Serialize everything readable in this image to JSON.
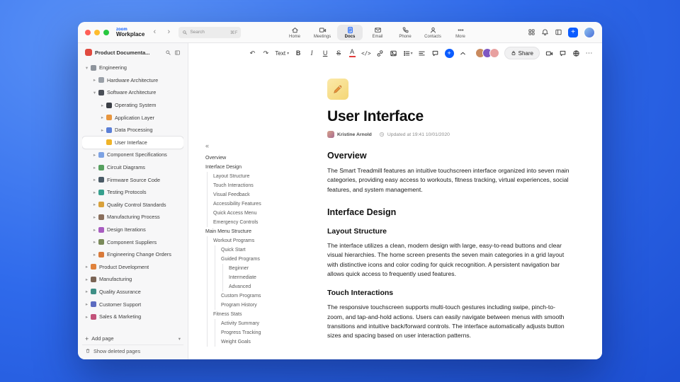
{
  "titlebar": {
    "logo_top": "zoom",
    "logo_bottom": "Workplace",
    "search_placeholder": "Search",
    "search_shortcut": "⌘F",
    "tabs": [
      {
        "label": "Home",
        "active": false
      },
      {
        "label": "Meetings",
        "active": false
      },
      {
        "label": "Docs",
        "active": true
      },
      {
        "label": "Email",
        "active": false
      },
      {
        "label": "Phone",
        "active": false
      },
      {
        "label": "Contacts",
        "active": false
      },
      {
        "label": "More",
        "active": false
      }
    ],
    "accent_color": "#0b5cff"
  },
  "sidebar": {
    "workspace_title": "Product Documenta...",
    "add_page_label": "Add page",
    "show_deleted_label": "Show deleted pages",
    "tree": [
      {
        "label": "Engineering",
        "level": 0,
        "chevron": "down",
        "icon": "gear",
        "color": "#8e949c"
      },
      {
        "label": "Hardware Architecture",
        "level": 1,
        "chevron": "right",
        "icon": "wrench",
        "color": "#9aa0a8"
      },
      {
        "label": "Software Architecture",
        "level": 1,
        "chevron": "down",
        "icon": "laptop",
        "color": "#4a4f57"
      },
      {
        "label": "Operating System",
        "level": 2,
        "chevron": "right",
        "icon": "disc",
        "color": "#3b3f46"
      },
      {
        "label": "Application Layer",
        "level": 2,
        "chevron": "right",
        "icon": "package",
        "color": "#e8963f"
      },
      {
        "label": "Data Processing",
        "level": 2,
        "chevron": "right",
        "icon": "chart",
        "color": "#5b7fd6"
      },
      {
        "label": "User Interface",
        "level": 2,
        "chevron": null,
        "icon": "memo",
        "color": "#f0b429",
        "selected": true
      },
      {
        "label": "Component Specifications",
        "level": 1,
        "chevron": "right",
        "icon": "clipboard",
        "color": "#7da2e3"
      },
      {
        "label": "Circuit Diagrams",
        "level": 1,
        "chevron": "right",
        "icon": "plug",
        "color": "#56a05f"
      },
      {
        "label": "Firmware Source Code",
        "level": 1,
        "chevron": "right",
        "icon": "floppy",
        "color": "#4a5a66"
      },
      {
        "label": "Testing Protocols",
        "level": 1,
        "chevron": "right",
        "icon": "test-tube",
        "color": "#37a08e"
      },
      {
        "label": "Quality Control Standards",
        "level": 1,
        "chevron": "right",
        "icon": "check-badge",
        "color": "#d9a13b"
      },
      {
        "label": "Manufacturing Process",
        "level": 1,
        "chevron": "right",
        "icon": "factory",
        "color": "#8a6f5c"
      },
      {
        "label": "Design Iterations",
        "level": 1,
        "chevron": "right",
        "icon": "pencil",
        "color": "#a85cc0"
      },
      {
        "label": "Component Suppliers",
        "level": 1,
        "chevron": "right",
        "icon": "box",
        "color": "#7a8a5a"
      },
      {
        "label": "Engineering Change Orders",
        "level": 1,
        "chevron": "right",
        "icon": "document",
        "color": "#d97a3a"
      },
      {
        "label": "Product Development",
        "level": 0,
        "chevron": "right",
        "icon": "rocket",
        "color": "#e0823c"
      },
      {
        "label": "Manufacturing",
        "level": 0,
        "chevron": "right",
        "icon": "factory",
        "color": "#7a6455"
      },
      {
        "label": "Quality Assurance",
        "level": 0,
        "chevron": "right",
        "icon": "magnifier",
        "color": "#3f8f86"
      },
      {
        "label": "Customer Support",
        "level": 0,
        "chevron": "right",
        "icon": "speech-bubble",
        "color": "#5c6bc0"
      },
      {
        "label": "Sales & Marketing",
        "level": 0,
        "chevron": "right",
        "icon": "chart-up",
        "color": "#c2527a"
      }
    ]
  },
  "editor_toolbar": {
    "text_style_label": "Text",
    "share_label": "Share",
    "avatars": [
      "#c98a5e",
      "#7e57c2",
      "#e8a0a0"
    ],
    "insert_color": "#0b5cff"
  },
  "outline": {
    "items": [
      {
        "label": "Overview",
        "level": 0
      },
      {
        "label": "Interface Design",
        "level": 0
      },
      {
        "label": "Layout Structure",
        "level": 1
      },
      {
        "label": "Touch Interactions",
        "level": 1
      },
      {
        "label": "Visual Feedback",
        "level": 1
      },
      {
        "label": "Accessibility Features",
        "level": 1
      },
      {
        "label": "Quick Access Menu",
        "level": 1
      },
      {
        "label": "Emergency Controls",
        "level": 1
      },
      {
        "label": "Main Menu Structure",
        "level": 0
      },
      {
        "label": "Workout Programs",
        "level": 1
      },
      {
        "label": "Quick Start",
        "level": 2
      },
      {
        "label": "Guided Programs",
        "level": 2
      },
      {
        "label": "Beginner",
        "level": 3
      },
      {
        "label": "Intermediate",
        "level": 3
      },
      {
        "label": "Advanced",
        "level": 3
      },
      {
        "label": "Custom Programs",
        "level": 2
      },
      {
        "label": "Program History",
        "level": 2
      },
      {
        "label": "Fitness Stats",
        "level": 1
      },
      {
        "label": "Activity Summary",
        "level": 2
      },
      {
        "label": "Progress Tracking",
        "level": 2
      },
      {
        "label": "Weight Goals",
        "level": 2
      }
    ]
  },
  "document": {
    "title": "User Interface",
    "author": "Kristine Arnold",
    "updated": "Updated at 19:41 10/01/2020",
    "sections": [
      {
        "type": "h2",
        "text": "Overview"
      },
      {
        "type": "p",
        "text": "The Smart Treadmill features an intuitive touchscreen interface organized into seven main categories, providing easy access to workouts, fitness tracking, virtual experiences, social features, and system management."
      },
      {
        "type": "h2",
        "text": "Interface Design"
      },
      {
        "type": "h3",
        "text": "Layout Structure"
      },
      {
        "type": "p",
        "text": "The interface utilizes a clean, modern design with large, easy-to-read buttons and clear visual hierarchies. The home screen presents the seven main categories in a grid layout with distinctive icons and color coding for quick recognition. A persistent navigation bar allows quick access to frequently used features."
      },
      {
        "type": "h3",
        "text": "Touch Interactions"
      },
      {
        "type": "p",
        "text": "The responsive touchscreen supports multi-touch gestures including swipe, pinch-to-zoom, and tap-and-hold actions. Users can easily navigate between menus with smooth transitions and intuitive back/forward controls. The interface automatically adjusts button sizes and spacing based on user interaction patterns."
      }
    ]
  }
}
